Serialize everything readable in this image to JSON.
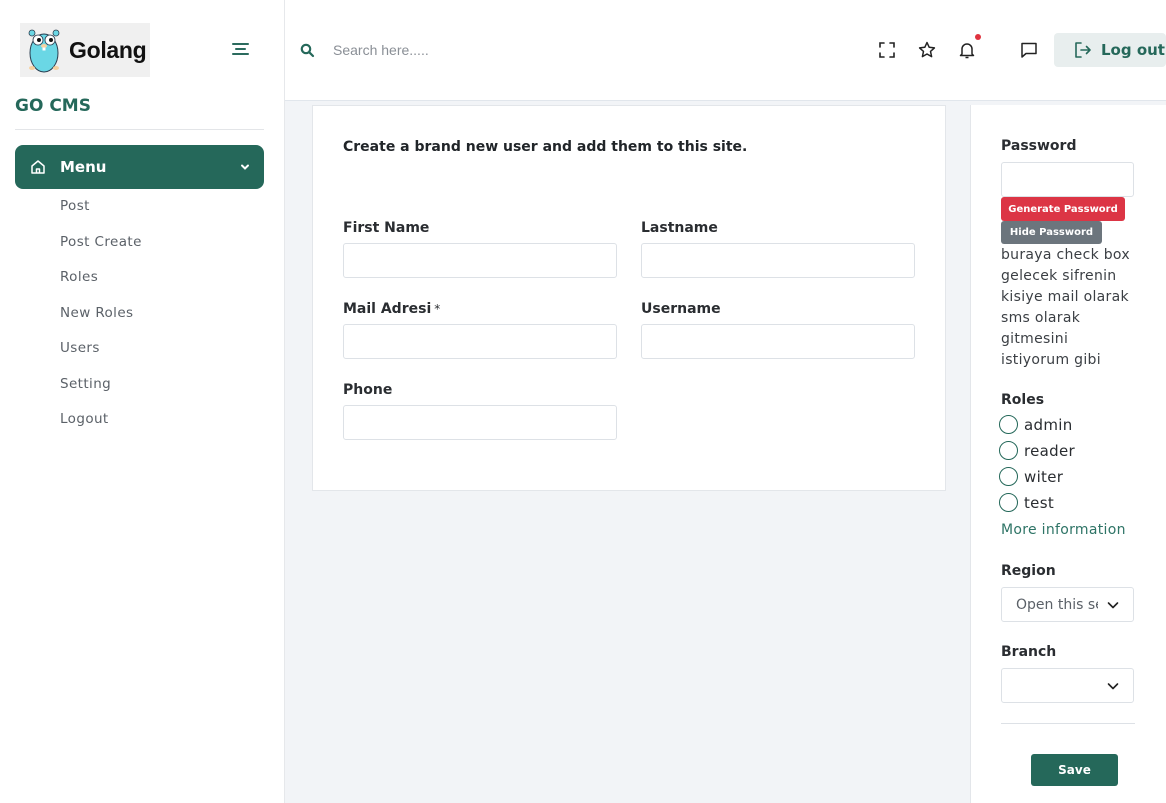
{
  "brand": {
    "logo_text": "Golang",
    "cms_title": "GO CMS"
  },
  "sidebar": {
    "menu_label": "Menu",
    "items": [
      {
        "label": "Post"
      },
      {
        "label": "Post Create"
      },
      {
        "label": "Roles"
      },
      {
        "label": "New Roles"
      },
      {
        "label": "Users"
      },
      {
        "label": "Setting"
      },
      {
        "label": "Logout"
      }
    ]
  },
  "topbar": {
    "search_placeholder": "Search here.....",
    "logout_label": "Log out",
    "icons": [
      "fullscreen-icon",
      "star-icon",
      "bell-icon",
      "message-icon",
      "logout-icon"
    ],
    "notification_dot_color": "#e0333f"
  },
  "form": {
    "heading": "Create a brand new user and add them to this site.",
    "first_name_label": "First Name",
    "lastname_label": "Lastname",
    "mail_label": "Mail Adresi",
    "mail_required_mark": "*",
    "username_label": "Username",
    "phone_label": "Phone"
  },
  "right_panel": {
    "password_label": "Password",
    "generate_password_label": "Generate Password",
    "hide_password_label": "Hide Password",
    "note": "buraya check box gelecek sifrenin kisiye mail olarak sms olarak gitmesini istiyorum gibi",
    "roles_label": "Roles",
    "roles": [
      "admin",
      "reader",
      "witer",
      "test"
    ],
    "more_info_label": "More information",
    "region_label": "Region",
    "region_value": "Open this select menu",
    "branch_label": "Branch",
    "branch_value": "",
    "save_label": "Save"
  },
  "colors": {
    "accent": "#25685a",
    "danger": "#dc3545",
    "secondary": "#6c757d"
  }
}
